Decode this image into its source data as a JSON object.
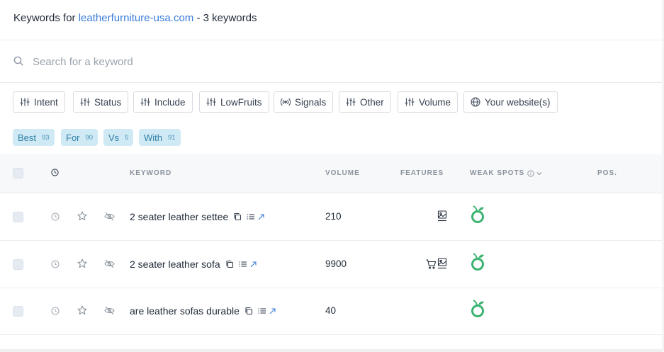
{
  "header": {
    "prefix": "Keywords for ",
    "domain": "leatherfurniture-usa.com",
    "suffix": " - 3 keywords"
  },
  "search": {
    "placeholder": "Search for a keyword",
    "icon": "search-icon"
  },
  "filters": [
    {
      "label": "Intent",
      "icon": "sliders-icon"
    },
    {
      "label": "Status",
      "icon": "sliders-icon"
    },
    {
      "label": "Include",
      "icon": "sliders-icon"
    },
    {
      "label": "LowFruits",
      "icon": "sliders-icon"
    },
    {
      "label": "Signals",
      "icon": "signal-icon"
    },
    {
      "label": "Other",
      "icon": "sliders-icon"
    },
    {
      "label": "Volume",
      "icon": "sliders-icon"
    },
    {
      "label": "Your website(s)",
      "icon": "globe-icon"
    }
  ],
  "tags": [
    {
      "label": "Best",
      "count": "93"
    },
    {
      "label": "For",
      "count": "90"
    },
    {
      "label": "Vs",
      "count": "5"
    },
    {
      "label": "With",
      "count": "91"
    }
  ],
  "table": {
    "columns": {
      "keyword": "KEYWORD",
      "volume": "VOLUME",
      "features": "FEATURES",
      "weak_spots": "WEAK SPOTS",
      "pos": "POS."
    },
    "rows": [
      {
        "keyword": "2 seater leather settee",
        "volume": "210",
        "features": [
          "image-icon"
        ],
        "weak_spot": "lowfruit-icon"
      },
      {
        "keyword": "2 seater leather sofa",
        "volume": "9900",
        "features": [
          "cart-icon",
          "image-icon"
        ],
        "weak_spot": "lowfruit-icon"
      },
      {
        "keyword": "are leather sofas durable",
        "volume": "40",
        "features": [],
        "weak_spot": "lowfruit-icon"
      }
    ]
  },
  "colors": {
    "link": "#3b7dd8",
    "tag_bg": "#cfeaf4",
    "tag_text": "#2f7fa6",
    "fruit_green": "#3cb371"
  }
}
